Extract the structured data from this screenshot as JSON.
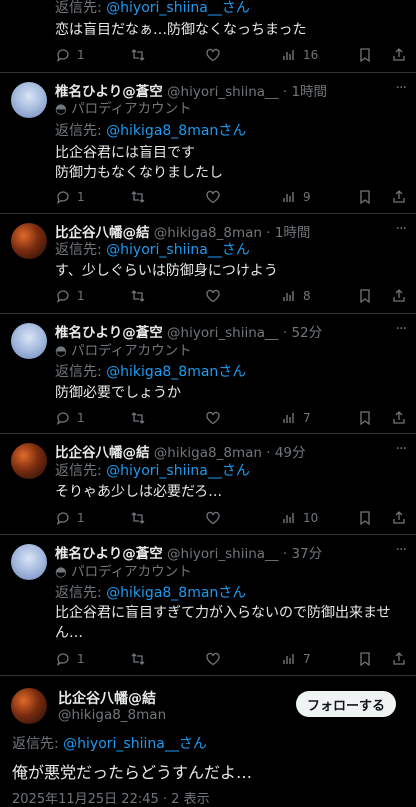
{
  "posts": [
    {
      "reply_prefix": "返信先:",
      "reply_to": "@hiyori_shiina__さん",
      "text": "恋は盲目だなぁ…防御なくなっちまった",
      "counts": {
        "reply": "1",
        "retweet": "",
        "like": "",
        "views": "16"
      }
    },
    {
      "name": "椎名ひより@蒼空",
      "handle": "@hiyori_shiina__",
      "time": "· 1時間",
      "parody": "パロディアカウント",
      "reply_prefix": "返信先:",
      "reply_to": "@hikiga8_8manさん",
      "text_lines": [
        "比企谷君には盲目です",
        "防御力もなくなりましたし"
      ],
      "counts": {
        "reply": "1",
        "retweet": "",
        "like": "",
        "views": "9"
      }
    },
    {
      "name": "比企谷八幡@結",
      "handle": "@hikiga8_8man",
      "time": "· 1時間",
      "reply_prefix": "返信先:",
      "reply_to": "@hiyori_shiina__さん",
      "text": "す、少しぐらいは防御身につけよう",
      "counts": {
        "reply": "1",
        "retweet": "",
        "like": "",
        "views": "8"
      }
    },
    {
      "name": "椎名ひより@蒼空",
      "handle": "@hiyori_shiina__",
      "time": "· 52分",
      "parody": "パロディアカウント",
      "reply_prefix": "返信先:",
      "reply_to": "@hikiga8_8manさん",
      "text": "防御必要でしょうか",
      "counts": {
        "reply": "1",
        "retweet": "",
        "like": "",
        "views": "7"
      }
    },
    {
      "name": "比企谷八幡@結",
      "handle": "@hikiga8_8man",
      "time": "· 49分",
      "reply_prefix": "返信先:",
      "reply_to": "@hiyori_shiina__さん",
      "text": "そりゃあ少しは必要だろ…",
      "counts": {
        "reply": "1",
        "retweet": "",
        "like": "",
        "views": "10"
      }
    },
    {
      "name": "椎名ひより@蒼空",
      "handle": "@hiyori_shiina__",
      "time": "· 37分",
      "parody": "パロディアカウント",
      "reply_prefix": "返信先:",
      "reply_to": "@hikiga8_8manさん",
      "text_lines": [
        "比企谷君に盲目すぎて力が入らないので防御出来ませ",
        "ん…"
      ],
      "counts": {
        "reply": "1",
        "retweet": "",
        "like": "",
        "views": "7"
      }
    }
  ],
  "main": {
    "name": "比企谷八幡@結",
    "handle": "@hikiga8_8man",
    "follow_label": "フォローする",
    "reply_prefix": "返信先:",
    "reply_to": "@hiyori_shiina__さん",
    "text": "俺が悪党だったらどうすんだよ…",
    "timestamp": "2025年11月25日 22:45 · 2 表示"
  },
  "icons": [
    "reply-icon",
    "retweet-icon",
    "like-icon",
    "views-icon",
    "bookmark-icon",
    "share-icon",
    "parody-mask-icon",
    "more-icon"
  ],
  "colors": {
    "background": "#000000",
    "text": "#e7e9ea",
    "muted": "#71767b",
    "link": "#1d9bf0",
    "divider": "#2f3336"
  }
}
